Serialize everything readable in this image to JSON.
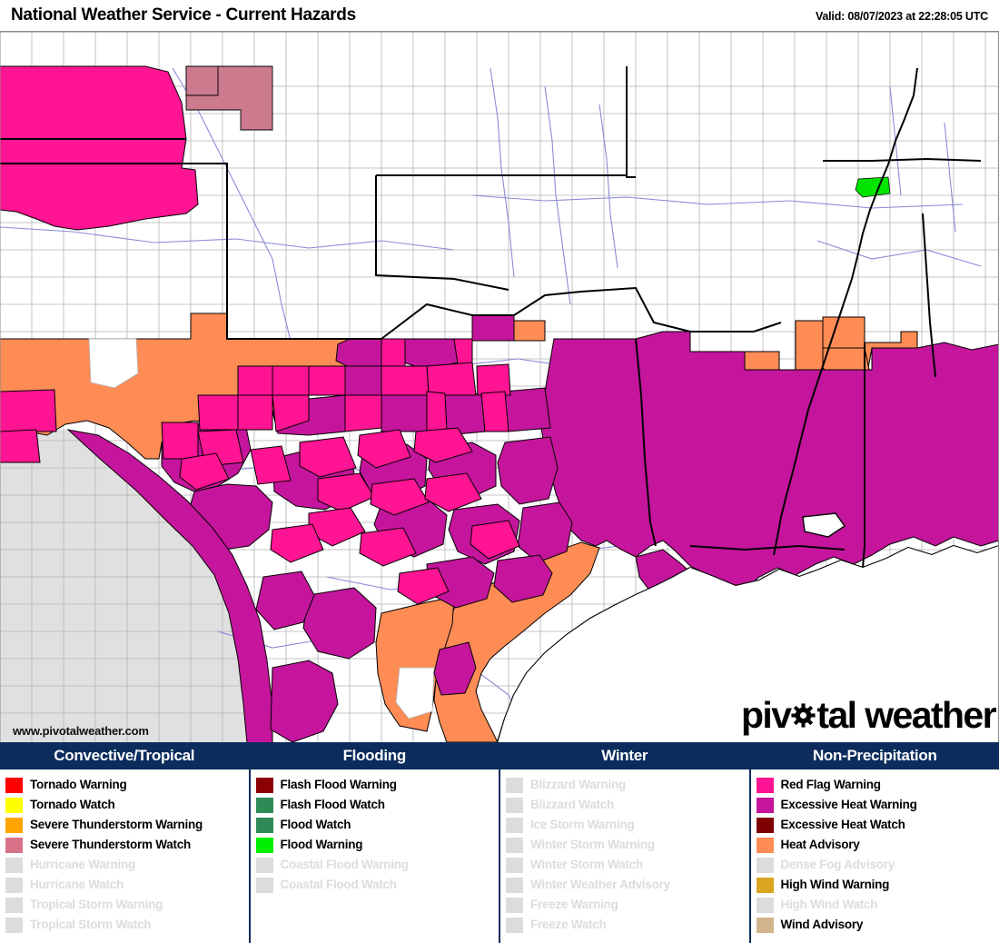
{
  "header": {
    "title": "National Weather Service - Current Hazards",
    "valid": "Valid: 08/07/2023 at 22:28:05 UTC"
  },
  "branding": {
    "url": "www.pivotalweather.com",
    "logo_part1": "piv",
    "logo_part2": "tal weather",
    "logo_icon": "gear-icon"
  },
  "colors": {
    "legend_header_bg": "#0b2c5c",
    "legend_header_text": "#ffffff",
    "disabled": "#dcdcdc",
    "map_land": "#ffffff",
    "map_outside": "#e0e0e0",
    "county_border": "#b4b4b4",
    "state_border": "#000000",
    "water_line": "#8a8ad8",
    "coastline": "#000000"
  },
  "map": {
    "hazard_fills": {
      "red_flag_warning": "#ff1493",
      "excessive_heat_warning": "#c4159c",
      "heat_advisory": "#ff8c55",
      "severe_thunderstorm_watch": "#cc7a8e",
      "flood_warning": "#00e400",
      "excessive_heat_watch": "#7f0000"
    },
    "hazard_outline": "#000000",
    "regions": [
      {
        "hazard": "red_flag_warning",
        "name": "nw-red-flag-area"
      },
      {
        "hazard": "severe_thunderstorm_watch",
        "name": "ne-severe-tstorm-watch"
      },
      {
        "hazard": "heat_advisory",
        "name": "west-texas-heat-advisory"
      },
      {
        "hazard": "excessive_heat_warning",
        "name": "texas-louisiana-heat-warning"
      },
      {
        "hazard": "flood_warning",
        "name": "tennessee-flood-warning"
      }
    ]
  },
  "legend": {
    "columns": [
      {
        "title": "Convective/Tropical",
        "items": [
          {
            "label": "Tornado Warning",
            "color": "#ff0000",
            "active": true
          },
          {
            "label": "Tornado Watch",
            "color": "#ffff00",
            "active": true
          },
          {
            "label": "Severe Thunderstorm Warning",
            "color": "#ffa500",
            "active": true
          },
          {
            "label": "Severe Thunderstorm Watch",
            "color": "#d77289",
            "active": true
          },
          {
            "label": "Hurricane Warning",
            "color": "#dcdcdc",
            "active": false
          },
          {
            "label": "Hurricane Watch",
            "color": "#dcdcdc",
            "active": false
          },
          {
            "label": "Tropical Storm Warning",
            "color": "#dcdcdc",
            "active": false
          },
          {
            "label": "Tropical Storm Watch",
            "color": "#dcdcdc",
            "active": false
          }
        ]
      },
      {
        "title": "Flooding",
        "items": [
          {
            "label": "Flash Flood Warning",
            "color": "#8b0000",
            "active": true
          },
          {
            "label": "Flash Flood Watch",
            "color": "#2e8b57",
            "active": true
          },
          {
            "label": "Flood Watch",
            "color": "#2e8b57",
            "active": true
          },
          {
            "label": "Flood Warning",
            "color": "#00ee00",
            "active": true
          },
          {
            "label": "Coastal Flood Warning",
            "color": "#dcdcdc",
            "active": false
          },
          {
            "label": "Coastal Flood Watch",
            "color": "#dcdcdc",
            "active": false
          }
        ]
      },
      {
        "title": "Winter",
        "items": [
          {
            "label": "Blizzard Warning",
            "color": "#dcdcdc",
            "active": false
          },
          {
            "label": "Blizzard Watch",
            "color": "#dcdcdc",
            "active": false
          },
          {
            "label": "Ice Storm Warning",
            "color": "#dcdcdc",
            "active": false
          },
          {
            "label": "Winter Storm Warning",
            "color": "#dcdcdc",
            "active": false
          },
          {
            "label": "Winter Storm Watch",
            "color": "#dcdcdc",
            "active": false
          },
          {
            "label": "Winter Weather Advisory",
            "color": "#dcdcdc",
            "active": false
          },
          {
            "label": "Freeze Warning",
            "color": "#dcdcdc",
            "active": false
          },
          {
            "label": "Freeze Watch",
            "color": "#dcdcdc",
            "active": false
          }
        ]
      },
      {
        "title": "Non-Precipitation",
        "items": [
          {
            "label": "Red Flag Warning",
            "color": "#ff1493",
            "active": true
          },
          {
            "label": "Excessive Heat Warning",
            "color": "#c4159c",
            "active": true
          },
          {
            "label": "Excessive Heat Watch",
            "color": "#7f0000",
            "active": true
          },
          {
            "label": "Heat Advisory",
            "color": "#ff8c55",
            "active": true
          },
          {
            "label": "Dense Fog Advisory",
            "color": "#dcdcdc",
            "active": false
          },
          {
            "label": "High Wind Warning",
            "color": "#daa520",
            "active": true
          },
          {
            "label": "High Wind Watch",
            "color": "#dcdcdc",
            "active": false
          },
          {
            "label": "Wind Advisory",
            "color": "#d2b48c",
            "active": true
          }
        ]
      }
    ]
  }
}
